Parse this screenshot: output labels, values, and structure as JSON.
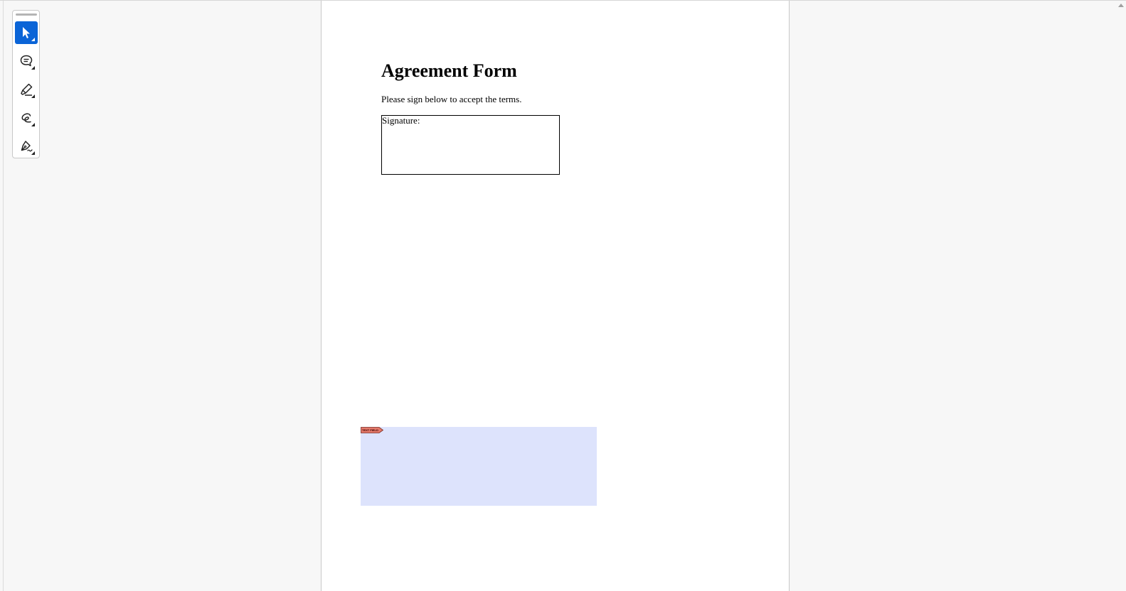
{
  "document": {
    "title": "Agreement Form",
    "instruction": "Please sign below to accept the terms.",
    "signature_label": "Signature:"
  },
  "form_field": {
    "tag_label": "TEXT FIELD",
    "highlight_color": "#dde3fc",
    "tag_color": "#e4796a"
  },
  "toolbar": {
    "tools": [
      {
        "name": "select-tool",
        "icon": "cursor-arrow-icon",
        "active": true
      },
      {
        "name": "comment-tool",
        "icon": "comment-bubble-icon",
        "active": false
      },
      {
        "name": "highlight-tool",
        "icon": "highlighter-icon",
        "active": false
      },
      {
        "name": "freehand-tool",
        "icon": "freehand-curve-icon",
        "active": false
      },
      {
        "name": "sign-tool",
        "icon": "pen-signature-icon",
        "active": false
      }
    ],
    "accent_color": "#0a64d7"
  }
}
